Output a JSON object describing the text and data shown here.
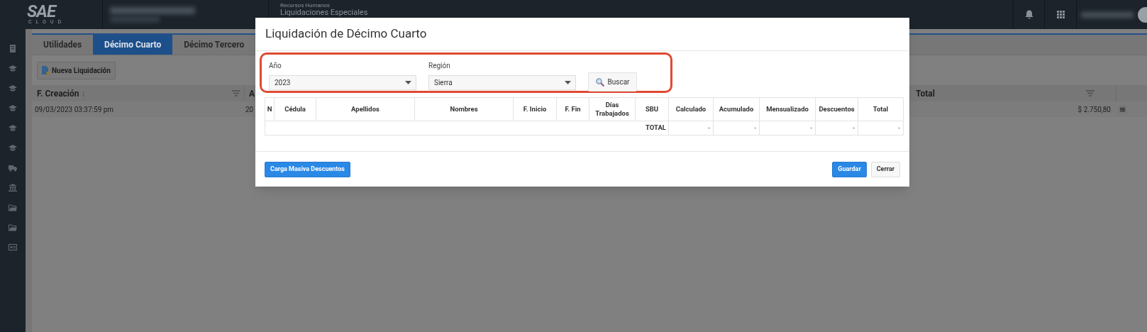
{
  "header": {
    "logo": {
      "mark": "SAE",
      "sub": "CLOUD"
    },
    "module": "Recursos Humanos",
    "page_title": "Liquidaciones Especiales"
  },
  "tabs": [
    {
      "label": "Utilidades",
      "selected": false
    },
    {
      "label": "Décimo Cuarto",
      "selected": true
    },
    {
      "label": "Décimo Tercero",
      "selected": false
    }
  ],
  "new_button": "Nueva Liquidación",
  "list_table": {
    "columns": [
      {
        "label": "F. Creación",
        "sort_marker": "↓"
      },
      {
        "label": "A"
      },
      {
        "label": "Total"
      }
    ],
    "rows": [
      {
        "created": "09/03/2023 03:37:59 pm",
        "column_2": "20",
        "total": "$ 2.750,80"
      }
    ]
  },
  "dialog": {
    "title": "Liquidación de Décimo Cuarto",
    "filters": [
      {
        "label": "Año",
        "value": "2023"
      },
      {
        "label": "Región",
        "value": "Sierra"
      }
    ],
    "search_button": "Buscar",
    "table": {
      "columns": [
        "N",
        "Cédula",
        "Apellidos",
        "Nombres",
        "F. Inicio",
        "F. Fin",
        "Días Trabajados",
        "SBU",
        "Calculado",
        "Acumulado",
        "Mensualizado",
        "Descuentos",
        "Total"
      ],
      "total_row": {
        "label": "TOTAL",
        "values": [
          "-",
          "-",
          "-",
          "-",
          "-"
        ]
      }
    },
    "buttons": [
      {
        "label": "Carga Masiva Descuentos",
        "kind": "primary"
      },
      {
        "label": "Guardar",
        "kind": "primary"
      },
      {
        "label": "Cerrar",
        "kind": "default"
      }
    ]
  }
}
